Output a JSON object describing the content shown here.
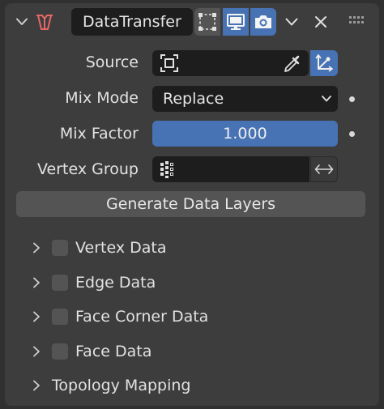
{
  "modifier": {
    "name": "DataTransfer",
    "icons": {
      "collapse": "chevron-down-icon",
      "modifier_type": "data-transfer-modifier-icon",
      "edit_mode": "edit-mode-icon",
      "viewport": "monitor-icon",
      "render": "camera-icon",
      "options": "chevron-down-icon",
      "remove": "close-icon",
      "drag": "drag-handle-icon"
    }
  },
  "properties": {
    "source": {
      "label": "Source",
      "value": ""
    },
    "mix_mode": {
      "label": "Mix Mode",
      "value": "Replace"
    },
    "mix_factor": {
      "label": "Mix Factor",
      "value": "1.000"
    },
    "vertex_group": {
      "label": "Vertex Group",
      "value": ""
    }
  },
  "generate_button": {
    "label": "Generate Data Layers"
  },
  "subpanels": [
    {
      "label": "Vertex Data",
      "checked": false
    },
    {
      "label": "Edge Data",
      "checked": false
    },
    {
      "label": "Face Corner Data",
      "checked": false
    },
    {
      "label": "Face Data",
      "checked": false
    },
    {
      "label": "Topology Mapping"
    }
  ],
  "colors": {
    "accent": "#4772b3",
    "modifier_icon": "#e86666",
    "panel": "#3d3d3d",
    "field": "#1d1d1d"
  }
}
